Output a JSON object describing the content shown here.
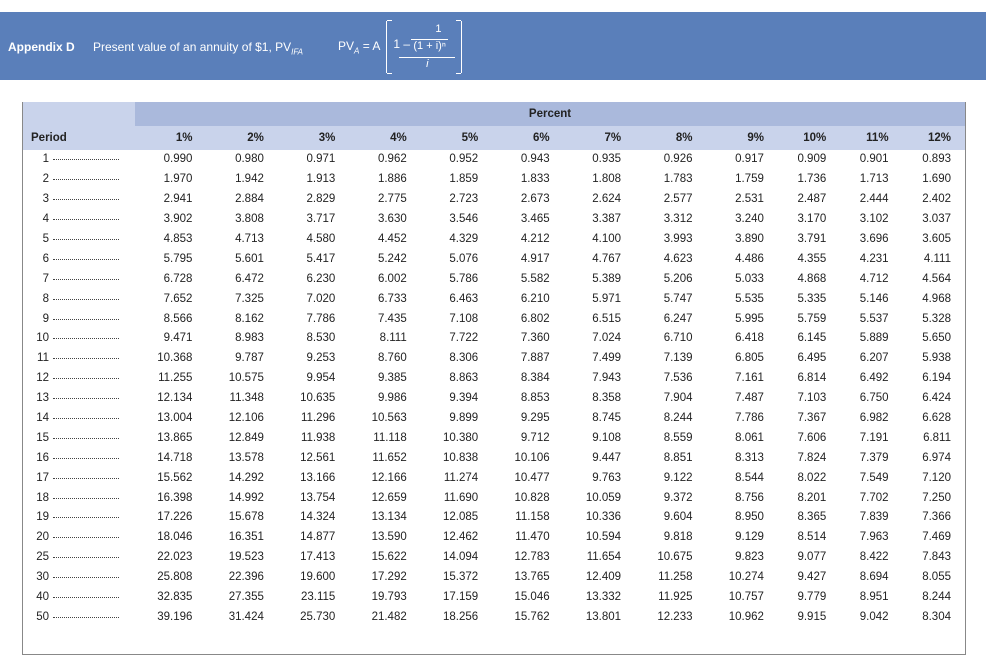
{
  "header": {
    "app_label": "Appendix D",
    "title_main": "Present value of an annuity of $1, PV",
    "title_sub": "IFA",
    "formula": {
      "lhs_main": "PV",
      "lhs_sub": "A",
      "lhs_rest": " = A",
      "one_minus": "1 –",
      "numerator": "1",
      "inner_denominator": "(1 + i)ⁿ",
      "outer_denominator": "i"
    }
  },
  "table": {
    "group_header": "Percent",
    "period_header": "Period",
    "columns": [
      "1%",
      "2%",
      "3%",
      "4%",
      "5%",
      "6%",
      "7%",
      "8%",
      "9%",
      "10%",
      "11%",
      "12%"
    ],
    "rows": [
      {
        "period": "1",
        "values": [
          "0.990",
          "0.980",
          "0.971",
          "0.962",
          "0.952",
          "0.943",
          "0.935",
          "0.926",
          "0.917",
          "0.909",
          "0.901",
          "0.893"
        ]
      },
      {
        "period": "2",
        "values": [
          "1.970",
          "1.942",
          "1.913",
          "1.886",
          "1.859",
          "1.833",
          "1.808",
          "1.783",
          "1.759",
          "1.736",
          "1.713",
          "1.690"
        ]
      },
      {
        "period": "3",
        "values": [
          "2.941",
          "2.884",
          "2.829",
          "2.775",
          "2.723",
          "2.673",
          "2.624",
          "2.577",
          "2.531",
          "2.487",
          "2.444",
          "2.402"
        ]
      },
      {
        "period": "4",
        "values": [
          "3.902",
          "3.808",
          "3.717",
          "3.630",
          "3.546",
          "3.465",
          "3.387",
          "3.312",
          "3.240",
          "3.170",
          "3.102",
          "3.037"
        ]
      },
      {
        "period": "5",
        "values": [
          "4.853",
          "4.713",
          "4.580",
          "4.452",
          "4.329",
          "4.212",
          "4.100",
          "3.993",
          "3.890",
          "3.791",
          "3.696",
          "3.605"
        ]
      },
      {
        "period": "6",
        "values": [
          "5.795",
          "5.601",
          "5.417",
          "5.242",
          "5.076",
          "4.917",
          "4.767",
          "4.623",
          "4.486",
          "4.355",
          "4.231",
          "4.111"
        ]
      },
      {
        "period": "7",
        "values": [
          "6.728",
          "6.472",
          "6.230",
          "6.002",
          "5.786",
          "5.582",
          "5.389",
          "5.206",
          "5.033",
          "4.868",
          "4.712",
          "4.564"
        ]
      },
      {
        "period": "8",
        "values": [
          "7.652",
          "7.325",
          "7.020",
          "6.733",
          "6.463",
          "6.210",
          "5.971",
          "5.747",
          "5.535",
          "5.335",
          "5.146",
          "4.968"
        ]
      },
      {
        "period": "9",
        "values": [
          "8.566",
          "8.162",
          "7.786",
          "7.435",
          "7.108",
          "6.802",
          "6.515",
          "6.247",
          "5.995",
          "5.759",
          "5.537",
          "5.328"
        ]
      },
      {
        "period": "10",
        "values": [
          "9.471",
          "8.983",
          "8.530",
          "8.111",
          "7.722",
          "7.360",
          "7.024",
          "6.710",
          "6.418",
          "6.145",
          "5.889",
          "5.650"
        ]
      },
      {
        "period": "11",
        "values": [
          "10.368",
          "9.787",
          "9.253",
          "8.760",
          "8.306",
          "7.887",
          "7.499",
          "7.139",
          "6.805",
          "6.495",
          "6.207",
          "5.938"
        ]
      },
      {
        "period": "12",
        "values": [
          "11.255",
          "10.575",
          "9.954",
          "9.385",
          "8.863",
          "8.384",
          "7.943",
          "7.536",
          "7.161",
          "6.814",
          "6.492",
          "6.194"
        ]
      },
      {
        "period": "13",
        "values": [
          "12.134",
          "11.348",
          "10.635",
          "9.986",
          "9.394",
          "8.853",
          "8.358",
          "7.904",
          "7.487",
          "7.103",
          "6.750",
          "6.424"
        ]
      },
      {
        "period": "14",
        "values": [
          "13.004",
          "12.106",
          "11.296",
          "10.563",
          "9.899",
          "9.295",
          "8.745",
          "8.244",
          "7.786",
          "7.367",
          "6.982",
          "6.628"
        ]
      },
      {
        "period": "15",
        "values": [
          "13.865",
          "12.849",
          "11.938",
          "11.118",
          "10.380",
          "9.712",
          "9.108",
          "8.559",
          "8.061",
          "7.606",
          "7.191",
          "6.811"
        ]
      },
      {
        "period": "16",
        "values": [
          "14.718",
          "13.578",
          "12.561",
          "11.652",
          "10.838",
          "10.106",
          "9.447",
          "8.851",
          "8.313",
          "7.824",
          "7.379",
          "6.974"
        ]
      },
      {
        "period": "17",
        "values": [
          "15.562",
          "14.292",
          "13.166",
          "12.166",
          "11.274",
          "10.477",
          "9.763",
          "9.122",
          "8.544",
          "8.022",
          "7.549",
          "7.120"
        ]
      },
      {
        "period": "18",
        "values": [
          "16.398",
          "14.992",
          "13.754",
          "12.659",
          "11.690",
          "10.828",
          "10.059",
          "9.372",
          "8.756",
          "8.201",
          "7.702",
          "7.250"
        ]
      },
      {
        "period": "19",
        "values": [
          "17.226",
          "15.678",
          "14.324",
          "13.134",
          "12.085",
          "11.158",
          "10.336",
          "9.604",
          "8.950",
          "8.365",
          "7.839",
          "7.366"
        ]
      },
      {
        "period": "20",
        "values": [
          "18.046",
          "16.351",
          "14.877",
          "13.590",
          "12.462",
          "11.470",
          "10.594",
          "9.818",
          "9.129",
          "8.514",
          "7.963",
          "7.469"
        ]
      },
      {
        "period": "25",
        "values": [
          "22.023",
          "19.523",
          "17.413",
          "15.622",
          "14.094",
          "12.783",
          "11.654",
          "10.675",
          "9.823",
          "9.077",
          "8.422",
          "7.843"
        ]
      },
      {
        "period": "30",
        "values": [
          "25.808",
          "22.396",
          "19.600",
          "17.292",
          "15.372",
          "13.765",
          "12.409",
          "11.258",
          "10.274",
          "9.427",
          "8.694",
          "8.055"
        ]
      },
      {
        "period": "40",
        "values": [
          "32.835",
          "27.355",
          "23.115",
          "19.793",
          "17.159",
          "15.046",
          "13.332",
          "11.925",
          "10.757",
          "9.779",
          "8.951",
          "8.244"
        ]
      },
      {
        "period": "50",
        "values": [
          "39.196",
          "31.424",
          "25.730",
          "21.482",
          "18.256",
          "15.762",
          "13.801",
          "12.233",
          "10.962",
          "9.915",
          "9.042",
          "8.304"
        ]
      }
    ]
  },
  "colors": {
    "banner": "#5a7fba",
    "percent_header": "#aab9dc",
    "column_header": "#c9d3eb"
  }
}
